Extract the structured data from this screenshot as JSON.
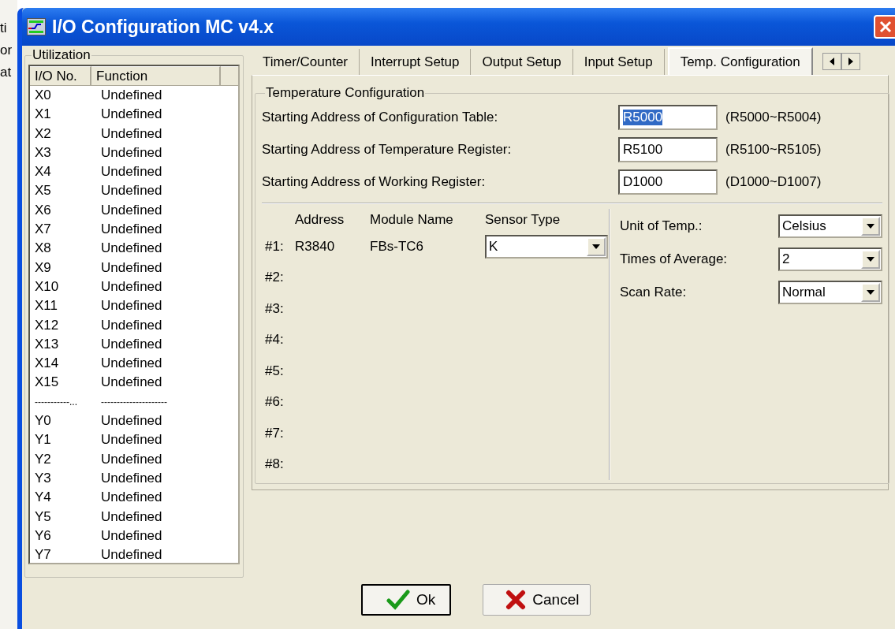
{
  "background_fragments": [
    "ti",
    "or",
    "at"
  ],
  "window": {
    "title": "I/O Configuration MC v4.x"
  },
  "utilization": {
    "title": "Utilization",
    "columns": [
      "I/O No.",
      "Function"
    ],
    "rows": [
      {
        "kind": "item",
        "io": "X0",
        "function": "Undefined"
      },
      {
        "kind": "item",
        "io": "X1",
        "function": "Undefined"
      },
      {
        "kind": "item",
        "io": "X2",
        "function": "Undefined"
      },
      {
        "kind": "item",
        "io": "X3",
        "function": "Undefined"
      },
      {
        "kind": "item",
        "io": "X4",
        "function": "Undefined"
      },
      {
        "kind": "item",
        "io": "X5",
        "function": "Undefined"
      },
      {
        "kind": "item",
        "io": "X6",
        "function": "Undefined"
      },
      {
        "kind": "item",
        "io": "X7",
        "function": "Undefined"
      },
      {
        "kind": "item",
        "io": "X8",
        "function": "Undefined"
      },
      {
        "kind": "item",
        "io": "X9",
        "function": "Undefined"
      },
      {
        "kind": "item",
        "io": "X10",
        "function": "Undefined"
      },
      {
        "kind": "item",
        "io": "X11",
        "function": "Undefined"
      },
      {
        "kind": "item",
        "io": "X12",
        "function": "Undefined"
      },
      {
        "kind": "item",
        "io": "X13",
        "function": "Undefined"
      },
      {
        "kind": "item",
        "io": "X14",
        "function": "Undefined"
      },
      {
        "kind": "item",
        "io": "X15",
        "function": "Undefined"
      },
      {
        "kind": "separator",
        "io": "-----------...",
        "function": "---------------------"
      },
      {
        "kind": "item",
        "io": "Y0",
        "function": "Undefined"
      },
      {
        "kind": "item",
        "io": "Y1",
        "function": "Undefined"
      },
      {
        "kind": "item",
        "io": "Y2",
        "function": "Undefined"
      },
      {
        "kind": "item",
        "io": "Y3",
        "function": "Undefined"
      },
      {
        "kind": "item",
        "io": "Y4",
        "function": "Undefined"
      },
      {
        "kind": "item",
        "io": "Y5",
        "function": "Undefined"
      },
      {
        "kind": "item",
        "io": "Y6",
        "function": "Undefined"
      },
      {
        "kind": "item",
        "io": "Y7",
        "function": "Undefined"
      }
    ]
  },
  "tabs": [
    {
      "label": "Timer/Counter",
      "selected": false
    },
    {
      "label": "Interrupt Setup",
      "selected": false
    },
    {
      "label": "Output Setup",
      "selected": false
    },
    {
      "label": "Input Setup",
      "selected": false
    },
    {
      "label": "Temp. Configuration",
      "selected": true
    }
  ],
  "temperature": {
    "title": "Temperature Configuration",
    "fields": [
      {
        "label": "Starting Address of Configuration Table:",
        "value": "R5000",
        "selected": true,
        "range": "(R5000~R5004)"
      },
      {
        "label": "Starting Address of Temperature Register:",
        "value": "R5100",
        "selected": false,
        "range": "(R5100~R5105)"
      },
      {
        "label": "Starting Address of Working Register:",
        "value": "D1000",
        "selected": false,
        "range": "(D1000~D1007)"
      }
    ],
    "columns": [
      "Address",
      "Module Name",
      "Sensor Type"
    ],
    "modules": [
      {
        "label": "#1:",
        "address": "R3840",
        "module": "FBs-TC6",
        "sensor": "K"
      },
      {
        "label": "#2:"
      },
      {
        "label": "#3:"
      },
      {
        "label": "#4:"
      },
      {
        "label": "#5:"
      },
      {
        "label": "#6:"
      },
      {
        "label": "#7:"
      },
      {
        "label": "#8:"
      }
    ],
    "settings": [
      {
        "label": "Unit of Temp.:",
        "value": "Celsius"
      },
      {
        "label": "Times of Average:",
        "value": "2"
      },
      {
        "label": "Scan Rate:",
        "value": "Normal"
      }
    ]
  },
  "buttons": [
    {
      "kind": "ok",
      "label": "Ok",
      "focused": true
    },
    {
      "kind": "cancel",
      "label": "Cancel",
      "focused": false
    }
  ]
}
